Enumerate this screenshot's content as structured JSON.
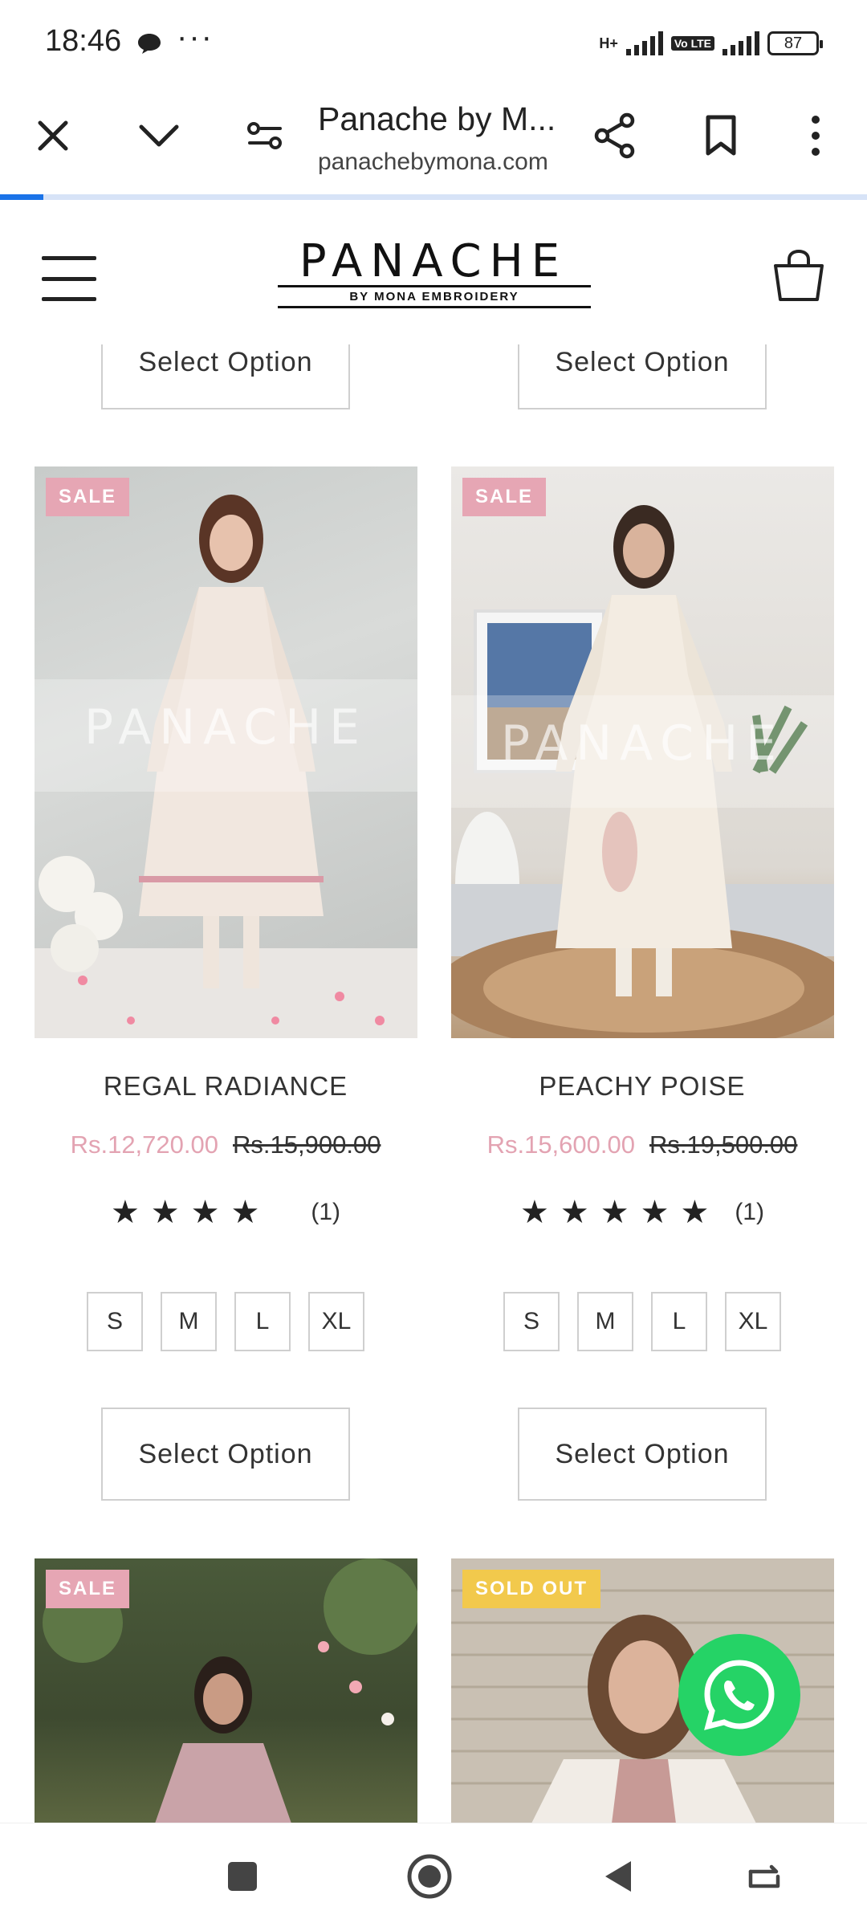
{
  "status_bar": {
    "time": "18:46",
    "dots": "···",
    "network_type": "H+",
    "lte_label": "Vo LTE",
    "battery": "87"
  },
  "browser": {
    "page_title": "Panache by M...",
    "url": "panachebymona.com",
    "load_progress": 0.05
  },
  "site": {
    "logo_text": "PANACHE",
    "logo_subtitle": "BY MONA EMBROIDERY"
  },
  "top_row": {
    "left_select": "Select Option",
    "right_select": "Select Option"
  },
  "products": [
    {
      "badge": "SALE",
      "name": "REGAL RADIANCE",
      "sale_price": "Rs.12,720.00",
      "original_price": "Rs.15,900.00",
      "stars": 4,
      "review_count": "(1)",
      "sizes": [
        "S",
        "M",
        "L",
        "XL"
      ],
      "select_label": "Select Option",
      "image_desc_color": "#cfd2cf"
    },
    {
      "badge": "SALE",
      "name": "PEACHY POISE",
      "sale_price": "Rs.15,600.00",
      "original_price": "Rs.19,500.00",
      "stars": 5,
      "review_count": "(1)",
      "sizes": [
        "S",
        "M",
        "L",
        "XL"
      ],
      "select_label": "Select Option",
      "image_desc_color": "#e4e2de"
    },
    {
      "badge": "SALE"
    },
    {
      "badge": "SOLD OUT"
    }
  ],
  "watermark": {
    "brand": "PANACHE"
  },
  "colors": {
    "sale_badge": "#e6a6b4",
    "sold_badge": "#f2c94c",
    "sale_price": "#e3a3b2",
    "whatsapp": "#25d366",
    "progress": "#1a73e8"
  }
}
